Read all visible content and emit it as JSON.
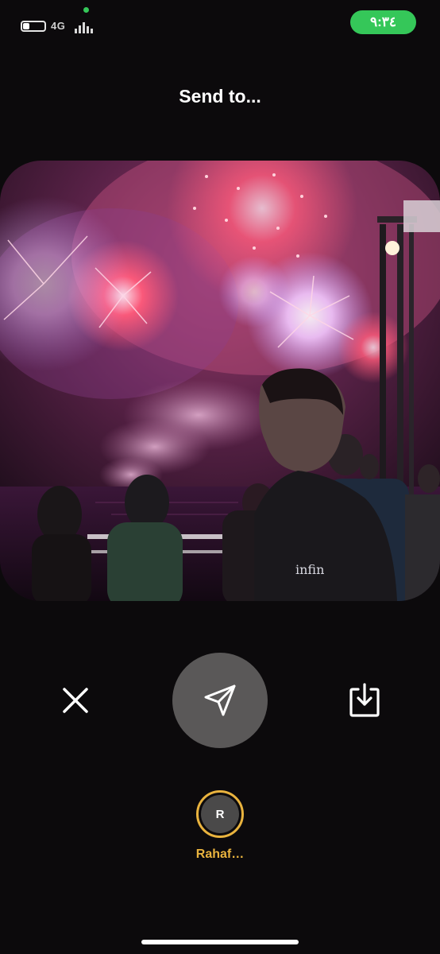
{
  "status_bar": {
    "network": "4G",
    "time": "٩:٣٤",
    "battery_level": 0.3,
    "recording_indicator_color": "#35c759"
  },
  "header": {
    "title": "Send to..."
  },
  "photo": {
    "icon": "fireworks-photo"
  },
  "actions": {
    "close_icon": "close-icon",
    "send_icon": "paper-plane-icon",
    "save_icon": "download-icon"
  },
  "recipients": [
    {
      "initial": "R",
      "name": "Rahaf…",
      "ring_color": "#e9b33e"
    }
  ],
  "colors": {
    "accent": "#e9b33e",
    "time_pill": "#35c759",
    "send_button": "#5a5858",
    "background": "#0c0a0c"
  }
}
